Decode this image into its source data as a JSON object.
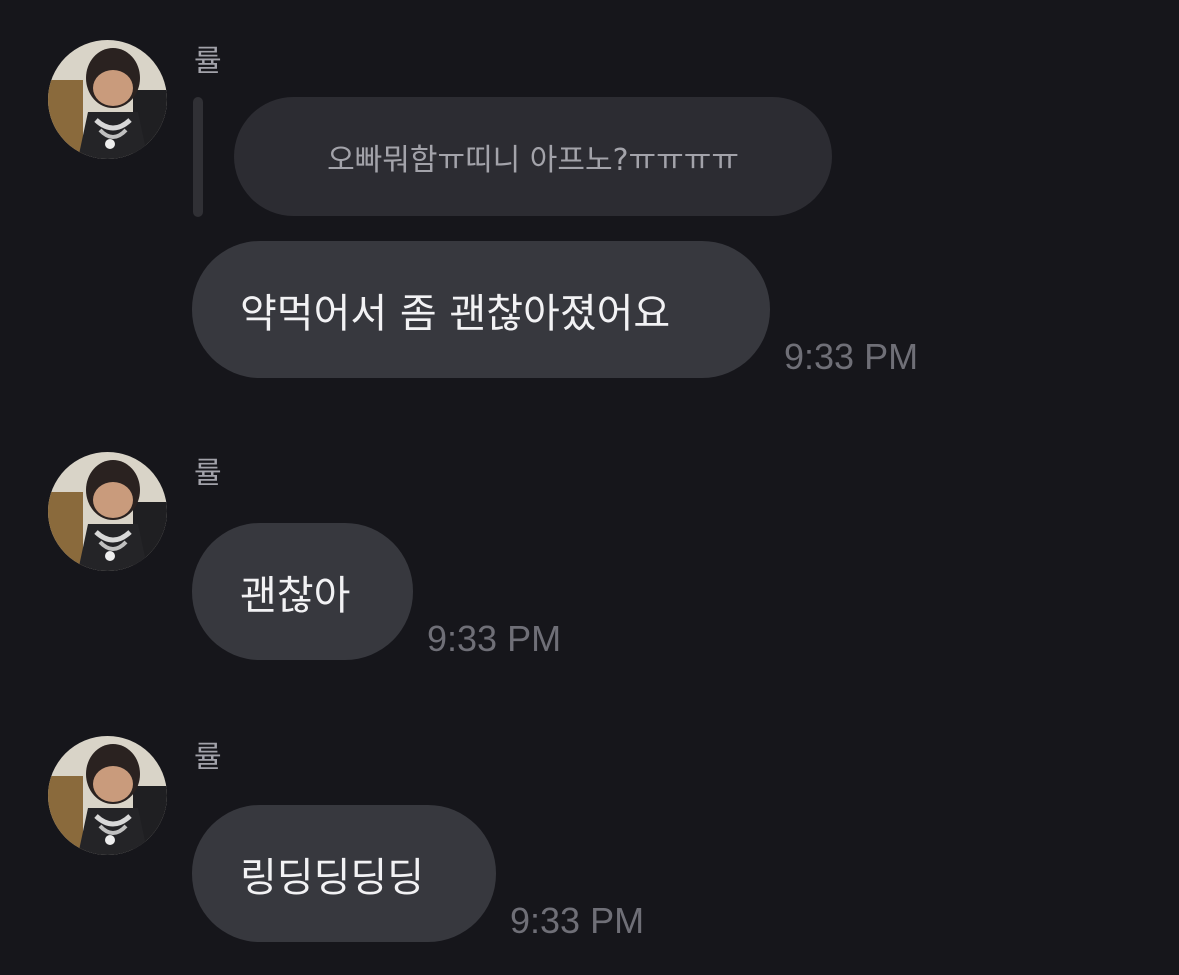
{
  "messages": [
    {
      "sender": "률",
      "reply_to": "오빠뭐함ㅠ띠니 아프노?ㅠㅠㅠㅠ",
      "text": "약먹어서 좀 괜찮아졌어요",
      "time": "9:33 PM"
    },
    {
      "sender": "률",
      "text": "괜찮아",
      "time": "9:33 PM"
    },
    {
      "sender": "률",
      "text": "링딩딩딩딩",
      "time": "9:33 PM"
    }
  ],
  "colors": {
    "background": "#16161b",
    "bubble": "#37383e",
    "reply_bubble": "#2c2c32",
    "timestamp": "#6f6f77"
  },
  "icons": [
    "avatar-photo"
  ]
}
